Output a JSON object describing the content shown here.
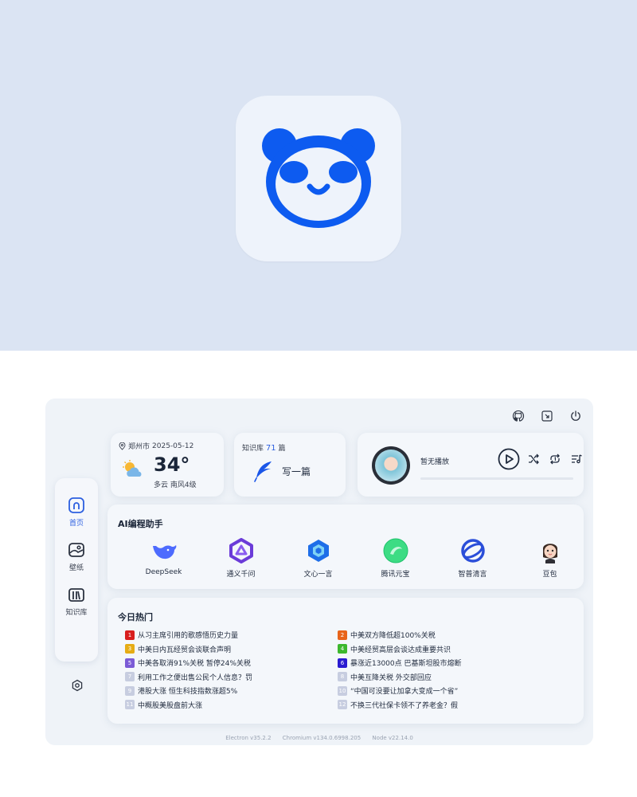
{
  "sidebar": {
    "items": [
      {
        "label": "首页",
        "icon": "home-icon",
        "active": true
      },
      {
        "label": "壁纸",
        "icon": "wallpaper-icon",
        "active": false
      },
      {
        "label": "知识库",
        "icon": "book-icon",
        "active": false
      }
    ],
    "settings_icon": "gear-icon"
  },
  "top_icons": [
    "github-icon",
    "minimize-icon",
    "power-icon"
  ],
  "weather": {
    "location": "郑州市",
    "date": "2025-05-12",
    "temperature": "34°",
    "condition": "多云 南风4级"
  },
  "knowledge": {
    "label_prefix": "知识库",
    "count": "71",
    "label_suffix": "篇",
    "write_label": "写一篇"
  },
  "music": {
    "status": "暂无播放",
    "progress": 0
  },
  "ai": {
    "title": "AI编程助手",
    "items": [
      {
        "label": "DeepSeek",
        "icon": "deepseek-icon"
      },
      {
        "label": "通义千问",
        "icon": "tongyi-icon"
      },
      {
        "label": "文心一言",
        "icon": "wenxin-icon"
      },
      {
        "label": "腾讯元宝",
        "icon": "yuanbao-icon"
      },
      {
        "label": "智普清言",
        "icon": "zhipu-icon"
      },
      {
        "label": "豆包",
        "icon": "doubao-icon"
      }
    ]
  },
  "hot": {
    "title": "今日热门",
    "items": [
      {
        "rank": "1",
        "title": "从习主席引用的歌感悟历史力量",
        "color": "#d81e1e"
      },
      {
        "rank": "2",
        "title": "中美双方降低超100%关税",
        "color": "#e8641b"
      },
      {
        "rank": "3",
        "title": "中美日内瓦经贸会谈联合声明",
        "color": "#e6ac15"
      },
      {
        "rank": "4",
        "title": "中美经贸高层会谈达成重要共识",
        "color": "#3db82e"
      },
      {
        "rank": "5",
        "title": "中美各取消91%关税 暂停24%关税",
        "color": "#7b5bd6"
      },
      {
        "rank": "6",
        "title": "暴涨近13000点 巴基斯坦股市熔断",
        "color": "#2a1bd1"
      },
      {
        "rank": "7",
        "title": "利用工作之便出售公民个人信息？罚",
        "color": "#c7cde0"
      },
      {
        "rank": "8",
        "title": "中美互降关税 外交部回应",
        "color": "#c7cde0"
      },
      {
        "rank": "9",
        "title": "港股大涨 恒生科技指数涨超5%",
        "color": "#c7cde0"
      },
      {
        "rank": "10",
        "title": "“中国可没要让加拿大变成一个省”",
        "color": "#c7cde0"
      },
      {
        "rank": "11",
        "title": "中概股美股盘前大涨",
        "color": "#c7cde0"
      },
      {
        "rank": "12",
        "title": "不换三代社保卡领不了养老金？假",
        "color": "#c7cde0"
      }
    ]
  },
  "footer": {
    "electron": "Electron v35.2.2",
    "chromium": "Chromium v134.0.6998.205",
    "node": "Node v22.14.0"
  }
}
